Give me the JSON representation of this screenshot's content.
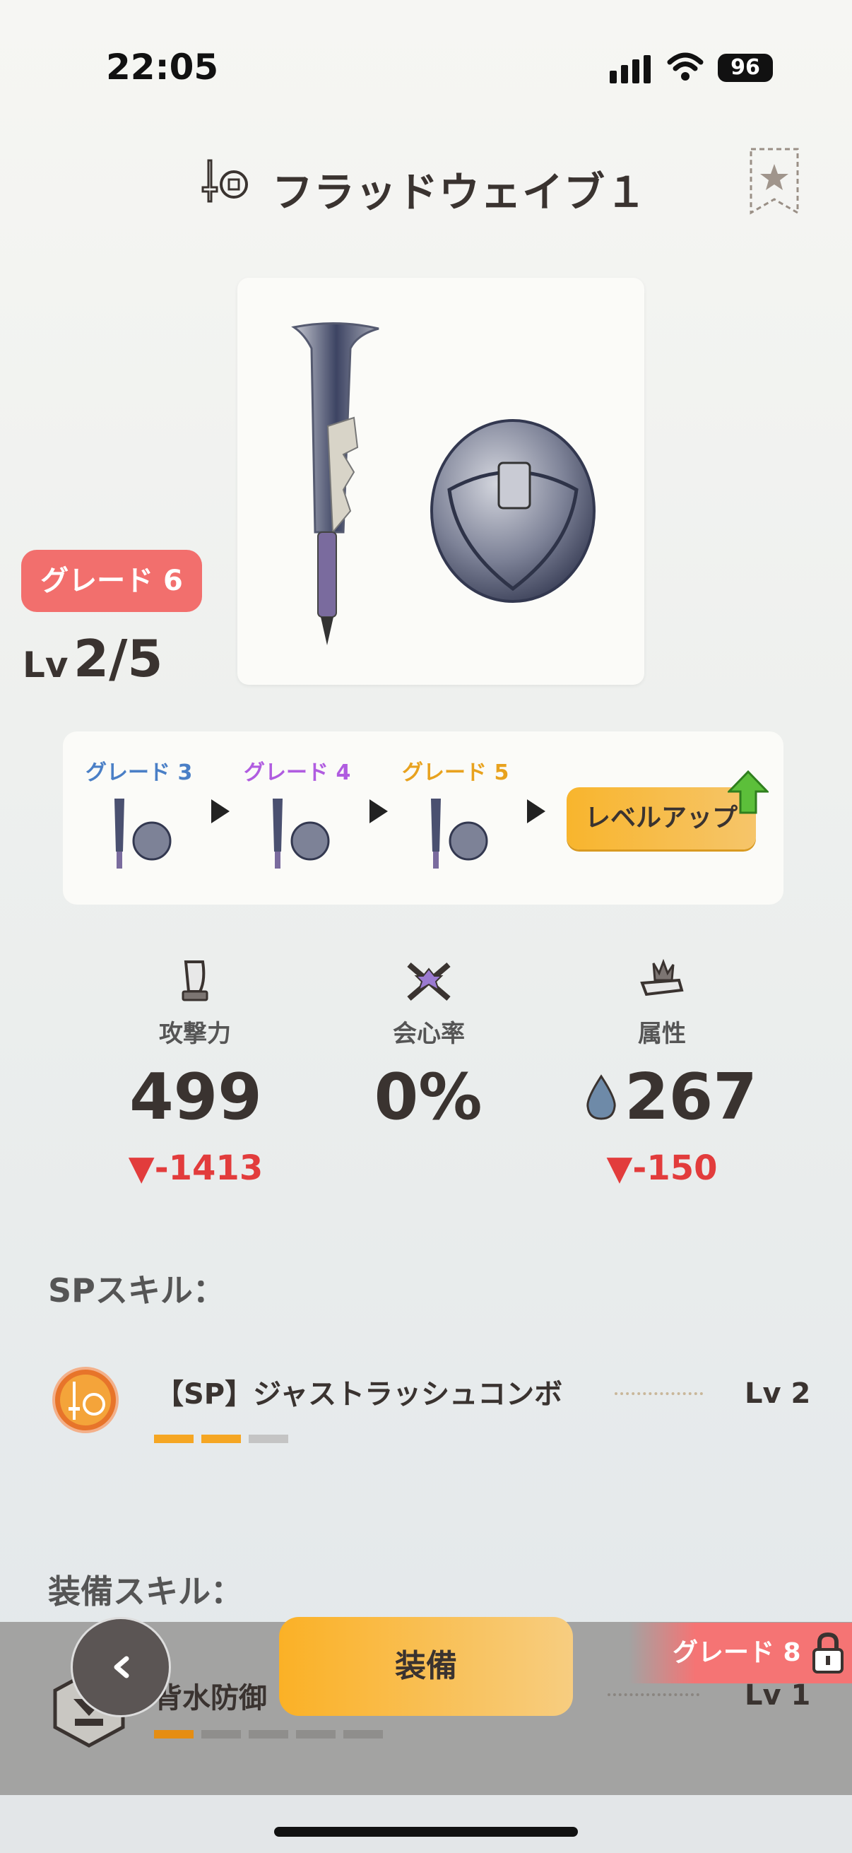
{
  "status_bar": {
    "time": "22:05",
    "battery": "96"
  },
  "header": {
    "title": "フラッドウェイブ１"
  },
  "weapon": {
    "grade_badge": "グレード 6",
    "level_prefix": "Lv",
    "level_value": "2/5"
  },
  "grade_steps": [
    {
      "label": "グレード 3",
      "color": "#4a7fc6"
    },
    {
      "label": "グレード 4",
      "color": "#b05ce0"
    },
    {
      "label": "グレード 5",
      "color": "#e8a21e"
    }
  ],
  "level_up_button": "レベルアップ",
  "stats": {
    "attack": {
      "label": "攻撃力",
      "value": "499",
      "delta": "▼-1413"
    },
    "critical": {
      "label": "会心率",
      "value": "0%"
    },
    "element": {
      "label": "属性",
      "value": "267",
      "delta": "▼-150"
    }
  },
  "sp_skills": {
    "heading": "SPスキル：",
    "items": [
      {
        "name": "【SP】ジャストラッシュコンボ",
        "level": "Lv 2",
        "filled": 2,
        "total": 3
      }
    ]
  },
  "equip_skills": {
    "heading": "装備スキル：",
    "items": [
      {
        "name": "背水防御",
        "level": "Lv 1",
        "filled": 1,
        "total": 5
      }
    ]
  },
  "bottom": {
    "equip_button": "装備",
    "locked_grade": "グレード 8"
  },
  "colors": {
    "accent": "#f8b52d",
    "grade_badge": "#f26f6d",
    "delta_negative": "#e23c3c"
  }
}
